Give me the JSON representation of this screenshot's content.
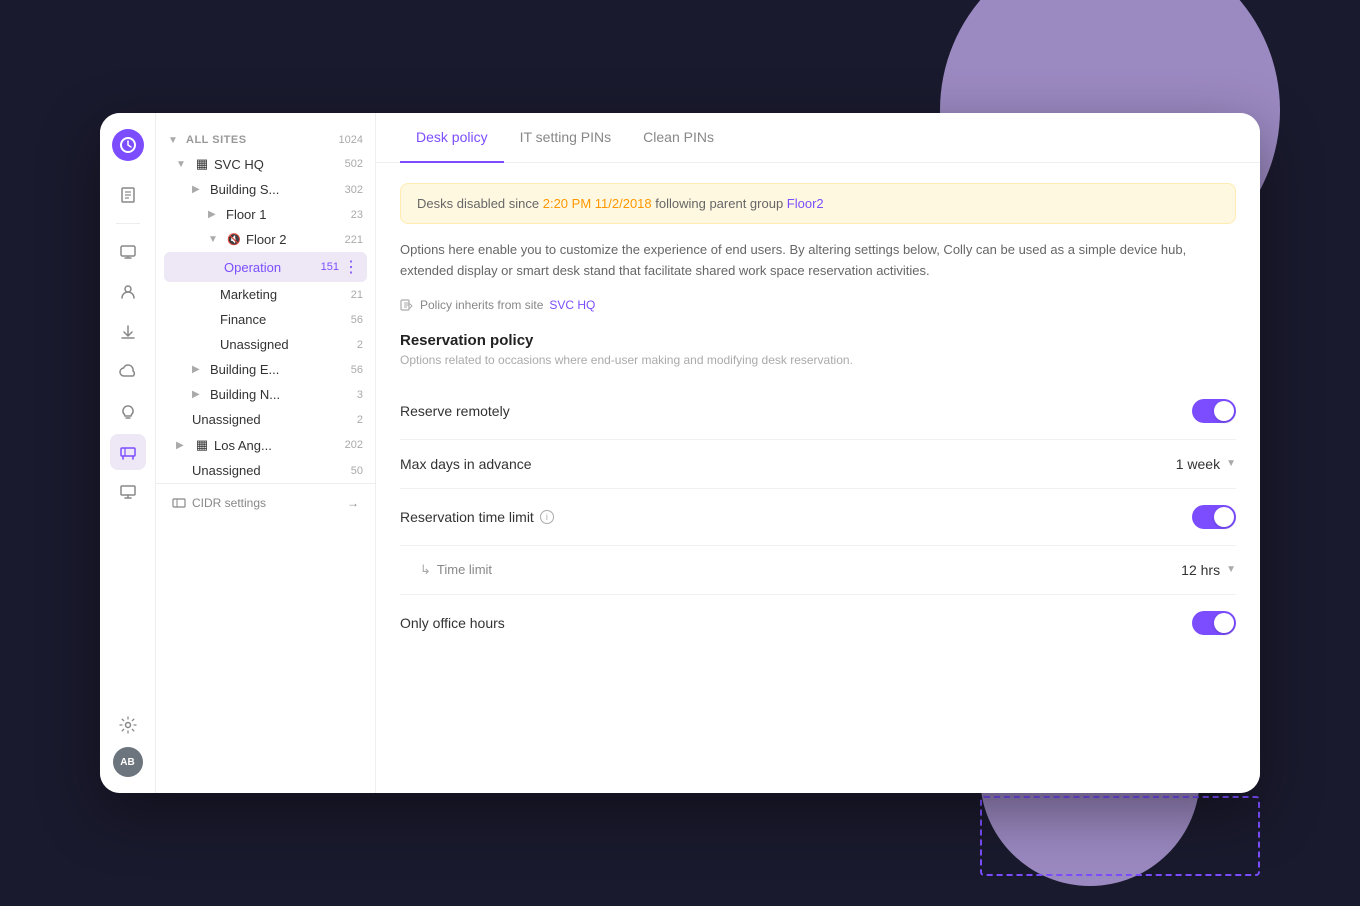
{
  "background": {
    "circle_top_color": "#b39ddb",
    "circle_bottom_color": "#b39ddb",
    "dashed_border_color": "#7c4dff"
  },
  "icon_sidebar": {
    "logo_text": "⟳",
    "nav_icons": [
      {
        "name": "book-icon",
        "symbol": "📋",
        "active": false
      },
      {
        "name": "device-icon",
        "symbol": "🖥",
        "active": false
      },
      {
        "name": "person-icon",
        "symbol": "👤",
        "active": false
      },
      {
        "name": "download-icon",
        "symbol": "⬇",
        "active": false
      },
      {
        "name": "cloud-icon",
        "symbol": "☁",
        "active": false
      },
      {
        "name": "bulb-icon",
        "symbol": "💡",
        "active": false
      },
      {
        "name": "desk-icon",
        "symbol": "🗂",
        "active": true
      },
      {
        "name": "monitor-icon",
        "symbol": "🖥",
        "active": false
      }
    ],
    "bottom_icons": [
      {
        "name": "settings-icon",
        "symbol": "⚙"
      },
      {
        "name": "avatar",
        "text": "AB"
      }
    ]
  },
  "tree_sidebar": {
    "items": [
      {
        "level": 0,
        "label": "ALL SITES",
        "count": "1024",
        "arrow": "▼",
        "icon": "",
        "active": false
      },
      {
        "level": 1,
        "label": "SVC HQ",
        "count": "502",
        "arrow": "▼",
        "icon": "▦",
        "active": false
      },
      {
        "level": 2,
        "label": "Building S...",
        "count": "302",
        "arrow": "▶",
        "icon": "",
        "active": false
      },
      {
        "level": 3,
        "label": "Floor 1",
        "count": "23",
        "arrow": "▶",
        "icon": "",
        "active": false
      },
      {
        "level": 3,
        "label": "Floor 2",
        "count": "221",
        "arrow": "▼",
        "icon": "🔇",
        "active": false
      },
      {
        "level": 4,
        "label": "Operation",
        "count": "151",
        "arrow": "",
        "icon": "",
        "active": true,
        "has_more": true
      },
      {
        "level": 4,
        "label": "Marketing",
        "count": "21",
        "arrow": "",
        "icon": "",
        "active": false
      },
      {
        "level": 4,
        "label": "Finance",
        "count": "56",
        "arrow": "",
        "icon": "",
        "active": false
      },
      {
        "level": 4,
        "label": "Unassigned",
        "count": "2",
        "arrow": "",
        "icon": "",
        "active": false
      },
      {
        "level": 2,
        "label": "Building E...",
        "count": "56",
        "arrow": "▶",
        "icon": "",
        "active": false
      },
      {
        "level": 2,
        "label": "Building N...",
        "count": "3",
        "arrow": "▶",
        "icon": "",
        "active": false
      },
      {
        "level": 2,
        "label": "Unassigned",
        "count": "2",
        "arrow": "",
        "icon": "",
        "active": false
      },
      {
        "level": 1,
        "label": "Los Ang...",
        "count": "202",
        "arrow": "▶",
        "icon": "▦",
        "active": false
      },
      {
        "level": 2,
        "label": "Unassigned",
        "count": "50",
        "arrow": "",
        "icon": "",
        "active": false
      }
    ],
    "cidr_settings": "CIDR settings"
  },
  "tabs": [
    {
      "label": "Desk policy",
      "active": true
    },
    {
      "label": "IT setting PINs",
      "active": false
    },
    {
      "label": "Clean PINs",
      "active": false
    }
  ],
  "alert": {
    "prefix": "Desks disabled since ",
    "time": "2:20 PM 11/2/2018",
    "middle": " following parent group ",
    "group": "Floor2"
  },
  "description": "Options here enable you to customize the experience of end users. By altering settings below, Colly can be used as a simple device hub, extended display or smart desk stand that facilitate shared work space reservation activities.",
  "policy_inherits": {
    "prefix": "Policy inherits from site ",
    "site": "SVC HQ"
  },
  "reservation_policy": {
    "title": "Reservation policy",
    "description": "Options related to occasions where end-user making and modifying desk reservation.",
    "rows": [
      {
        "label": "Reserve remotely",
        "type": "toggle",
        "value": true,
        "value_text": ""
      },
      {
        "label": "Max days in advance",
        "type": "dropdown",
        "value_text": "1 week"
      },
      {
        "label": "Reservation time limit",
        "type": "toggle",
        "value": true,
        "has_info": true
      },
      {
        "label": "Time limit",
        "type": "dropdown",
        "value_text": "12 hrs",
        "indent": true
      },
      {
        "label": "Only office hours",
        "type": "toggle",
        "value": true
      }
    ]
  }
}
